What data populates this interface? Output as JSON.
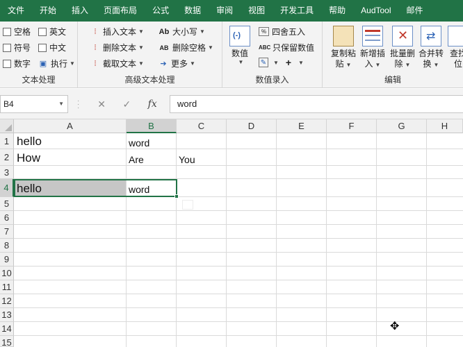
{
  "ribbon_tabs": [
    "文件",
    "开始",
    "插入",
    "页面布局",
    "公式",
    "数据",
    "审阅",
    "视图",
    "开发工具",
    "帮助",
    "AudTool",
    "邮件"
  ],
  "groups": {
    "text_process": {
      "label": "文本处理",
      "items": [
        "空格",
        "英文",
        "符号",
        "中文",
        "数字",
        "执行"
      ]
    },
    "advanced_text": {
      "label": "高级文本处理",
      "items": [
        "插入文本",
        "大小写",
        "删除文本",
        "删除空格",
        "截取文本",
        "更多"
      ]
    },
    "data_entry": {
      "label": "数值录入",
      "numeric_label": "数值",
      "round_label": "四舍五入",
      "keep_values_label": "只保留数值"
    },
    "edit": {
      "label": "编辑",
      "buttons": [
        {
          "l1": "复制粘",
          "l2": "贴"
        },
        {
          "l1": "新增插",
          "l2": "入"
        },
        {
          "l1": "批量删",
          "l2": "除"
        },
        {
          "l1": "合并转",
          "l2": "换"
        },
        {
          "l1": "查找",
          "l2": "位"
        }
      ]
    }
  },
  "formula_bar": {
    "name_box": "B4",
    "formula": "word",
    "cancel_symbol": "✕",
    "enter_symbol": "✓",
    "fx_symbol": "fx"
  },
  "columns": [
    "A",
    "B",
    "C",
    "D",
    "E",
    "F",
    "G",
    "H"
  ],
  "selected_column": "B",
  "rows": [
    "1",
    "2",
    "3",
    "4",
    "5",
    "6",
    "7",
    "8",
    "9",
    "10",
    "11",
    "12",
    "13",
    "14",
    "15"
  ],
  "selected_row": "4",
  "cells": {
    "A1": "hello",
    "B1": "word",
    "A2": "How",
    "B2": "Are",
    "C2": "You",
    "A4": "hello",
    "B4": "word"
  },
  "colors": {
    "accent": "#217346",
    "ribbon_bg": "#f3f3f3"
  }
}
